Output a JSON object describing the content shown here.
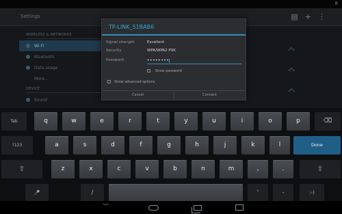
{
  "status_bar": {
    "time": "8"
  },
  "action_bar": {
    "title": "Settings"
  },
  "settings": {
    "section_header": "WIRELESS & NETWORKS",
    "items": [
      {
        "label": "Wi-Fi",
        "selected": true
      },
      {
        "label": "Bluetooth",
        "selected": false
      },
      {
        "label": "Data usage",
        "selected": false
      },
      {
        "label": "More...",
        "selected": false
      },
      {
        "label": "DEVICE",
        "selected": false
      },
      {
        "label": "Sound",
        "selected": false
      }
    ]
  },
  "dialog": {
    "title": "TP-LINK_51BAB6",
    "rows": [
      {
        "label": "Signal strength",
        "value": "Excellent"
      },
      {
        "label": "Security",
        "value": "WPA/WPA2 PSK"
      }
    ],
    "password_label": "Password",
    "password_value": "••••••••",
    "show_password": "Show password",
    "show_advanced": "Show advanced options",
    "cancel": "Cancel",
    "connect": "Connect"
  },
  "keyboard": {
    "row1": [
      "q",
      "w",
      "e",
      "r",
      "t",
      "y",
      "u",
      "i",
      "o",
      "p"
    ],
    "row2": [
      "a",
      "s",
      "d",
      "f",
      "g",
      "h",
      "j",
      "k",
      "l"
    ],
    "row3": [
      "z",
      "x",
      "c",
      "v",
      "b",
      "n",
      "m",
      ",",
      "."
    ],
    "tab": "Tab",
    "backspace": "⌫",
    "symbols": "?123",
    "done": "Done",
    "shift": "⇧",
    "mic": "🎤",
    "slash": "/",
    "apostrophe": "'",
    "dash": "-",
    "smiley": ":-)"
  },
  "nav": {
    "back": "﹀"
  },
  "colors": {
    "accent": "#39a8d6",
    "done_key": "#1f5f86"
  }
}
